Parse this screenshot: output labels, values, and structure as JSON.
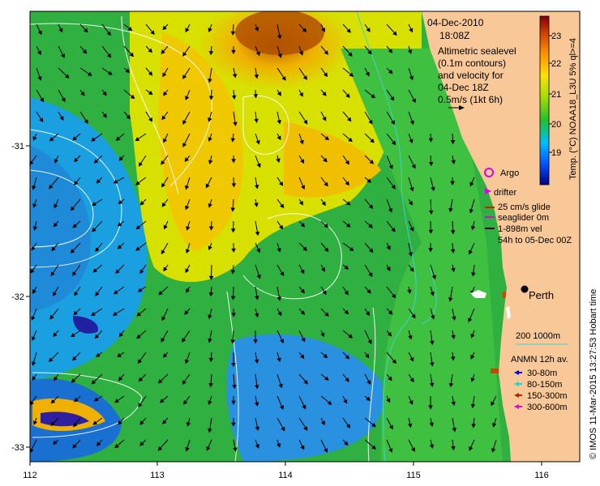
{
  "info": {
    "date": "04-Dec-2010",
    "time": "18:08Z",
    "line1": "Altimetric sealevel",
    "line2": "(0.1m contours)",
    "line3": "and velocity for",
    "line4": "04-Dec 18Z",
    "line5": "0.5m/s (1kt 6h)"
  },
  "legend": {
    "argo": "Argo",
    "drifter": "drifter",
    "glide": "25 cm/s glide",
    "seaglider": "seaglider 0m",
    "vel": "1-898m vel",
    "period": "54h to 05-Dec 00Z",
    "city": "Perth",
    "depth": "200  1000m",
    "anmn_title": "ANMN 12h av.",
    "anmn": [
      "30-80m",
      "80-150m",
      "150-300m",
      "300-600m"
    ]
  },
  "colors": {
    "argo": "#e000e0",
    "drifter": "#e000e0",
    "glide": "#d02000",
    "seaglider": "#e000e0",
    "vel": "#000000",
    "depth": "#40d0d0",
    "anmn": [
      "#0000ff",
      "#00e0e0",
      "#c02000",
      "#e000e0"
    ],
    "land": "#f8c898",
    "colorbar": [
      "#000080",
      "#0050ff",
      "#00c0ff",
      "#20c030",
      "#a0e000",
      "#ffe000",
      "#ff9000",
      "#d04000",
      "#800000"
    ]
  },
  "colorbar": {
    "ticks": [
      "23",
      "22",
      "21",
      "20",
      "19"
    ],
    "label": "Temp. (°C) NOAA18_L3U 5% ql>=4"
  },
  "axes": {
    "x_ticks": [
      "112",
      "113",
      "114",
      "115",
      "116"
    ],
    "y_ticks": [
      "-31",
      "-32",
      "-33"
    ]
  },
  "credit": "© IMOS 11-Mar-2015 13:27:53 Hobart time"
}
